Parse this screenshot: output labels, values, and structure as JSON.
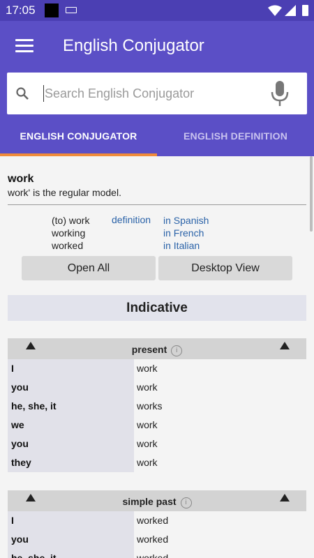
{
  "status": {
    "time": "17:05"
  },
  "app": {
    "title": "English Conjugator"
  },
  "search": {
    "placeholder": "Search English Conjugator"
  },
  "tabs": [
    {
      "label": "ENGLISH CONJUGATOR"
    },
    {
      "label": "ENGLISH DEFINITION"
    }
  ],
  "verb": {
    "infinitive": "work",
    "model_note": "work' is the regular model.",
    "forms": [
      "(to) work",
      "working",
      "worked"
    ],
    "definition_link": "definition",
    "translations": [
      "in Spanish",
      "in French",
      "in Italian"
    ]
  },
  "buttons": {
    "open_all": "Open All",
    "desktop_view": "Desktop View"
  },
  "mood": "Indicative",
  "tenses": [
    {
      "name": "present",
      "info": "i",
      "rows": [
        {
          "pronoun": "I",
          "form": "work"
        },
        {
          "pronoun": "you",
          "form": "work"
        },
        {
          "pronoun": "he, she, it",
          "form": "works"
        },
        {
          "pronoun": "we",
          "form": "work"
        },
        {
          "pronoun": "you",
          "form": "work"
        },
        {
          "pronoun": "they",
          "form": "work"
        }
      ]
    },
    {
      "name": "simple past",
      "info": "i",
      "rows": [
        {
          "pronoun": "I",
          "form": "worked"
        },
        {
          "pronoun": "you",
          "form": "worked"
        },
        {
          "pronoun": "he, she, it",
          "form": "worked"
        }
      ]
    }
  ],
  "colors": {
    "app_bar": "#5b4fc6",
    "status_bar": "#4b3fb3",
    "tab_indicator": "#f08b3a",
    "link": "#2a62a8"
  },
  "icons": [
    "menu-icon",
    "search-icon",
    "microphone-icon",
    "info-icon",
    "expand-up-icon",
    "wifi-icon",
    "signal-icon",
    "battery-icon"
  ]
}
